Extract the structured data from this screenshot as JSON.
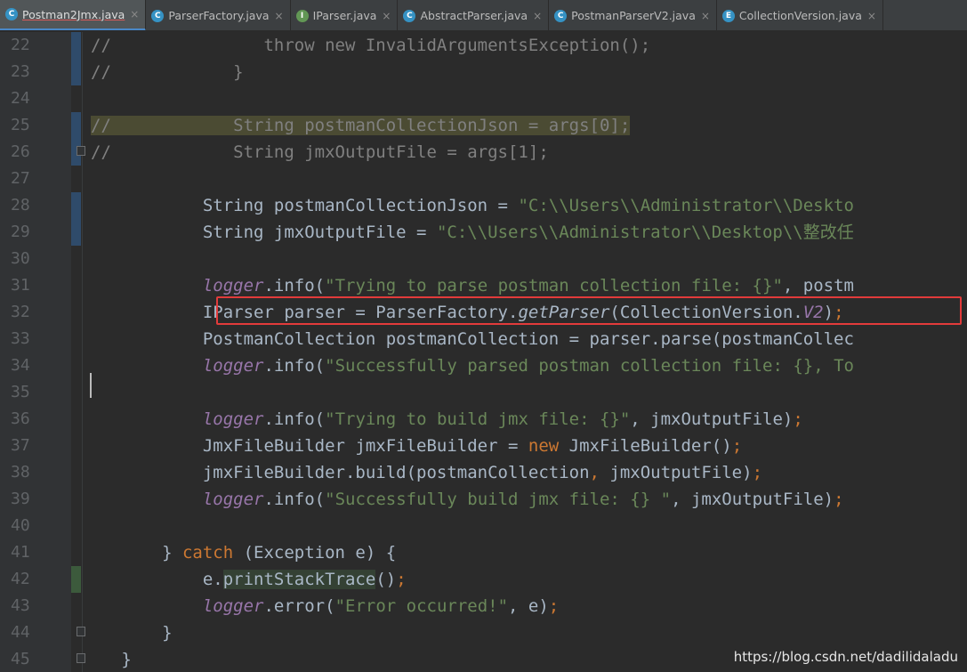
{
  "tabs": [
    {
      "label": "Postman2Jmx.java",
      "icon": "C",
      "icon_color": "#3592c4",
      "active": true,
      "underline": true
    },
    {
      "label": "ParserFactory.java",
      "icon": "C",
      "icon_color": "#3592c4",
      "active": false,
      "underline": false
    },
    {
      "label": "IParser.java",
      "icon": "I",
      "icon_color": "#629755",
      "active": false,
      "underline": false
    },
    {
      "label": "AbstractParser.java",
      "icon": "C",
      "icon_color": "#3592c4",
      "active": false,
      "underline": false
    },
    {
      "label": "PostmanParserV2.java",
      "icon": "C",
      "icon_color": "#3592c4",
      "active": false,
      "underline": false
    },
    {
      "label": "CollectionVersion.java",
      "icon": "E",
      "icon_color": "#3592c4",
      "active": false,
      "underline": false
    }
  ],
  "tab_close_glyph": "×",
  "lines": [
    {
      "no": "22",
      "tokens": [
        [
          "cm",
          "//               throw new InvalidArgumentsException();"
        ]
      ]
    },
    {
      "no": "23",
      "tokens": [
        [
          "cm",
          "//            }"
        ]
      ]
    },
    {
      "no": "24",
      "tokens": []
    },
    {
      "no": "25",
      "tokens": [
        [
          "cm hl-search",
          "//            String postmanCollectionJson = args[0];"
        ]
      ]
    },
    {
      "no": "26",
      "tokens": [
        [
          "cm",
          "//            String jmxOutputFile = args[1];"
        ]
      ]
    },
    {
      "no": "27",
      "tokens": []
    },
    {
      "no": "28",
      "tokens": [
        [
          "",
          "           String postmanCollectionJson = "
        ],
        [
          "str",
          "\"C:\\\\Users\\\\Administrator\\\\Deskto"
        ]
      ]
    },
    {
      "no": "29",
      "tokens": [
        [
          "",
          "           String jmxOutputFile = "
        ],
        [
          "str",
          "\"C:\\\\Users\\\\Administrator\\\\Desktop\\\\整改任"
        ]
      ]
    },
    {
      "no": "30",
      "tokens": []
    },
    {
      "no": "31",
      "tokens": [
        [
          "",
          "           "
        ],
        [
          "fld",
          "logger"
        ],
        [
          "",
          ".info("
        ],
        [
          "str",
          "\"Trying to parse postman collection file: {}\""
        ],
        [
          "",
          ", postm"
        ]
      ]
    },
    {
      "no": "32",
      "tokens": [
        [
          "",
          "           IParser parser = ParserFactory."
        ],
        [
          "it",
          "getParser"
        ],
        [
          "",
          "(CollectionVersion."
        ],
        [
          "fld",
          "V2"
        ],
        [
          "",
          ")"
        ],
        [
          "kw",
          ";"
        ]
      ]
    },
    {
      "no": "33",
      "tokens": [
        [
          "",
          "           PostmanCollection postmanCollection = parser.parse(postmanCollec"
        ]
      ]
    },
    {
      "no": "34",
      "tokens": [
        [
          "",
          "           "
        ],
        [
          "fld",
          "logger"
        ],
        [
          "",
          ".info("
        ],
        [
          "str",
          "\"Successfully parsed postman collection file: {}, To"
        ]
      ]
    },
    {
      "no": "35",
      "tokens": []
    },
    {
      "no": "36",
      "tokens": [
        [
          "",
          "           "
        ],
        [
          "fld",
          "logger"
        ],
        [
          "",
          ".info("
        ],
        [
          "str",
          "\"Trying to build jmx file: {}\""
        ],
        [
          "",
          ", jmxOutputFile)"
        ],
        [
          "kw",
          ";"
        ]
      ]
    },
    {
      "no": "37",
      "tokens": [
        [
          "",
          "           JmxFileBuilder jmxFileBuilder = "
        ],
        [
          "kw",
          "new "
        ],
        [
          "",
          "JmxFileBuilder()"
        ],
        [
          "kw",
          ";"
        ]
      ]
    },
    {
      "no": "38",
      "tokens": [
        [
          "",
          "           jmxFileBuilder.build(postmanCollection"
        ],
        [
          "kw",
          ", "
        ],
        [
          "",
          "jmxOutputFile)"
        ],
        [
          "kw",
          ";"
        ]
      ]
    },
    {
      "no": "39",
      "tokens": [
        [
          "",
          "           "
        ],
        [
          "fld",
          "logger"
        ],
        [
          "",
          ".info("
        ],
        [
          "str",
          "\"Successfully build jmx file: {} \""
        ],
        [
          "",
          ", jmxOutputFile)"
        ],
        [
          "kw",
          ";"
        ]
      ]
    },
    {
      "no": "40",
      "tokens": []
    },
    {
      "no": "41",
      "tokens": [
        [
          "",
          "       } "
        ],
        [
          "kw",
          "catch "
        ],
        [
          "",
          "(Exception e) {"
        ]
      ]
    },
    {
      "no": "42",
      "tokens": [
        [
          "",
          "           e."
        ],
        [
          "hl-method",
          "printStackTrace"
        ],
        [
          "",
          "()"
        ],
        [
          "kw",
          ";"
        ]
      ]
    },
    {
      "no": "43",
      "tokens": [
        [
          "",
          "           "
        ],
        [
          "fld",
          "logger"
        ],
        [
          "",
          ".error("
        ],
        [
          "str",
          "\"Error occurred!\""
        ],
        [
          "",
          ", e)"
        ],
        [
          "kw",
          ";"
        ]
      ]
    },
    {
      "no": "44",
      "tokens": [
        [
          "",
          "       }"
        ]
      ]
    },
    {
      "no": "45",
      "tokens": [
        [
          "",
          "   }"
        ]
      ]
    }
  ],
  "watermark": "https://blog.csdn.net/dadilidaladu"
}
